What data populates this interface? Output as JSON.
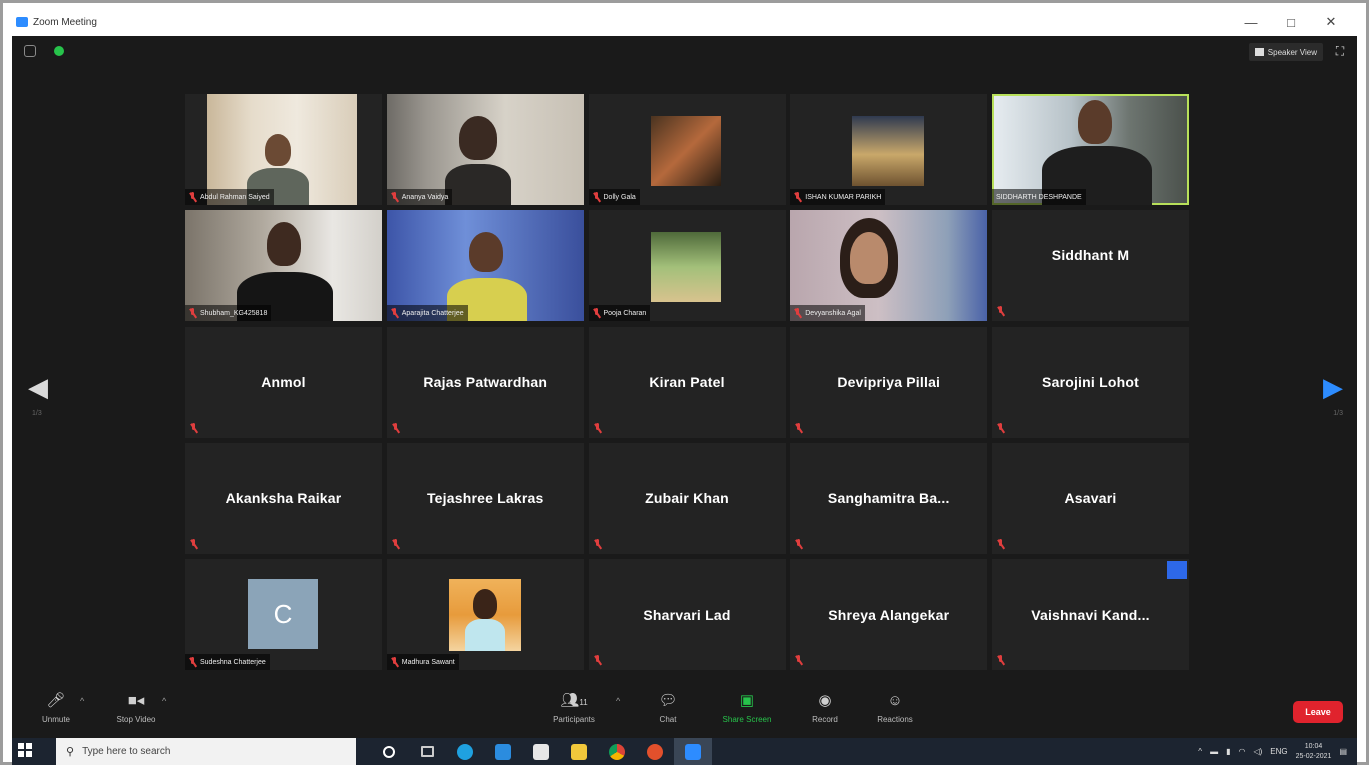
{
  "window": {
    "title": "Zoom Meeting",
    "controls": [
      "—",
      "□",
      "✕"
    ]
  },
  "topbar": {
    "speaker_view_label": "Speaker View"
  },
  "gallery": {
    "prev_page": "1/3",
    "next_page": "1/3",
    "video_tiles": [
      {
        "name": "Abdul Rahman Saiyed"
      },
      {
        "name": "Ananya Vaidya"
      },
      {
        "name": "Dolly Gala"
      },
      {
        "name": "ISHAN KUMAR PARIKH"
      },
      {
        "name": "SIDDHARTH DESHPANDE"
      },
      {
        "name": "Shubham_KG425818"
      },
      {
        "name": "Aparajita Chatterjee"
      },
      {
        "name": "Pooja Charan"
      },
      {
        "name": "Devyanshika Agal"
      }
    ],
    "name_tiles": [
      {
        "name": "Siddhant M"
      },
      {
        "name": "Anmol"
      },
      {
        "name": "Rajas Patwardhan"
      },
      {
        "name": "Kiran Patel"
      },
      {
        "name": "Devipriya Pillai"
      },
      {
        "name": "Sarojini Lohot"
      },
      {
        "name": "Akanksha Raikar"
      },
      {
        "name": "Tejashree Lakras"
      },
      {
        "name": "Zubair Khan"
      },
      {
        "name": "Sanghamitra  Ba..."
      },
      {
        "name": "Asavari"
      }
    ],
    "last_row": [
      {
        "avatar_letter": "C",
        "name": "Sudeshna Chatterjee"
      },
      {
        "name": "Madhura Sawant"
      },
      {
        "name": "Sharvari Lad"
      },
      {
        "name": "Shreya Alangekar"
      },
      {
        "name": "Vaishnavi  Kand..."
      }
    ]
  },
  "toolbar": {
    "unmute": "Unmute",
    "stop_video": "Stop Video",
    "participants": "Participants",
    "participants_count": "11",
    "chat": "Chat",
    "share_screen": "Share Screen",
    "record": "Record",
    "reactions": "Reactions",
    "leave": "Leave"
  },
  "taskbar": {
    "search_placeholder": "Type here to search",
    "language": "ENG",
    "time": "10:04",
    "date": "25-02-2021"
  },
  "colors": {
    "accent_blue": "#2d8cff",
    "active_speaker": "#b8e05a",
    "muted_red": "#e03e3e",
    "share_green": "#27c34b",
    "leave_red": "#e0232d"
  }
}
